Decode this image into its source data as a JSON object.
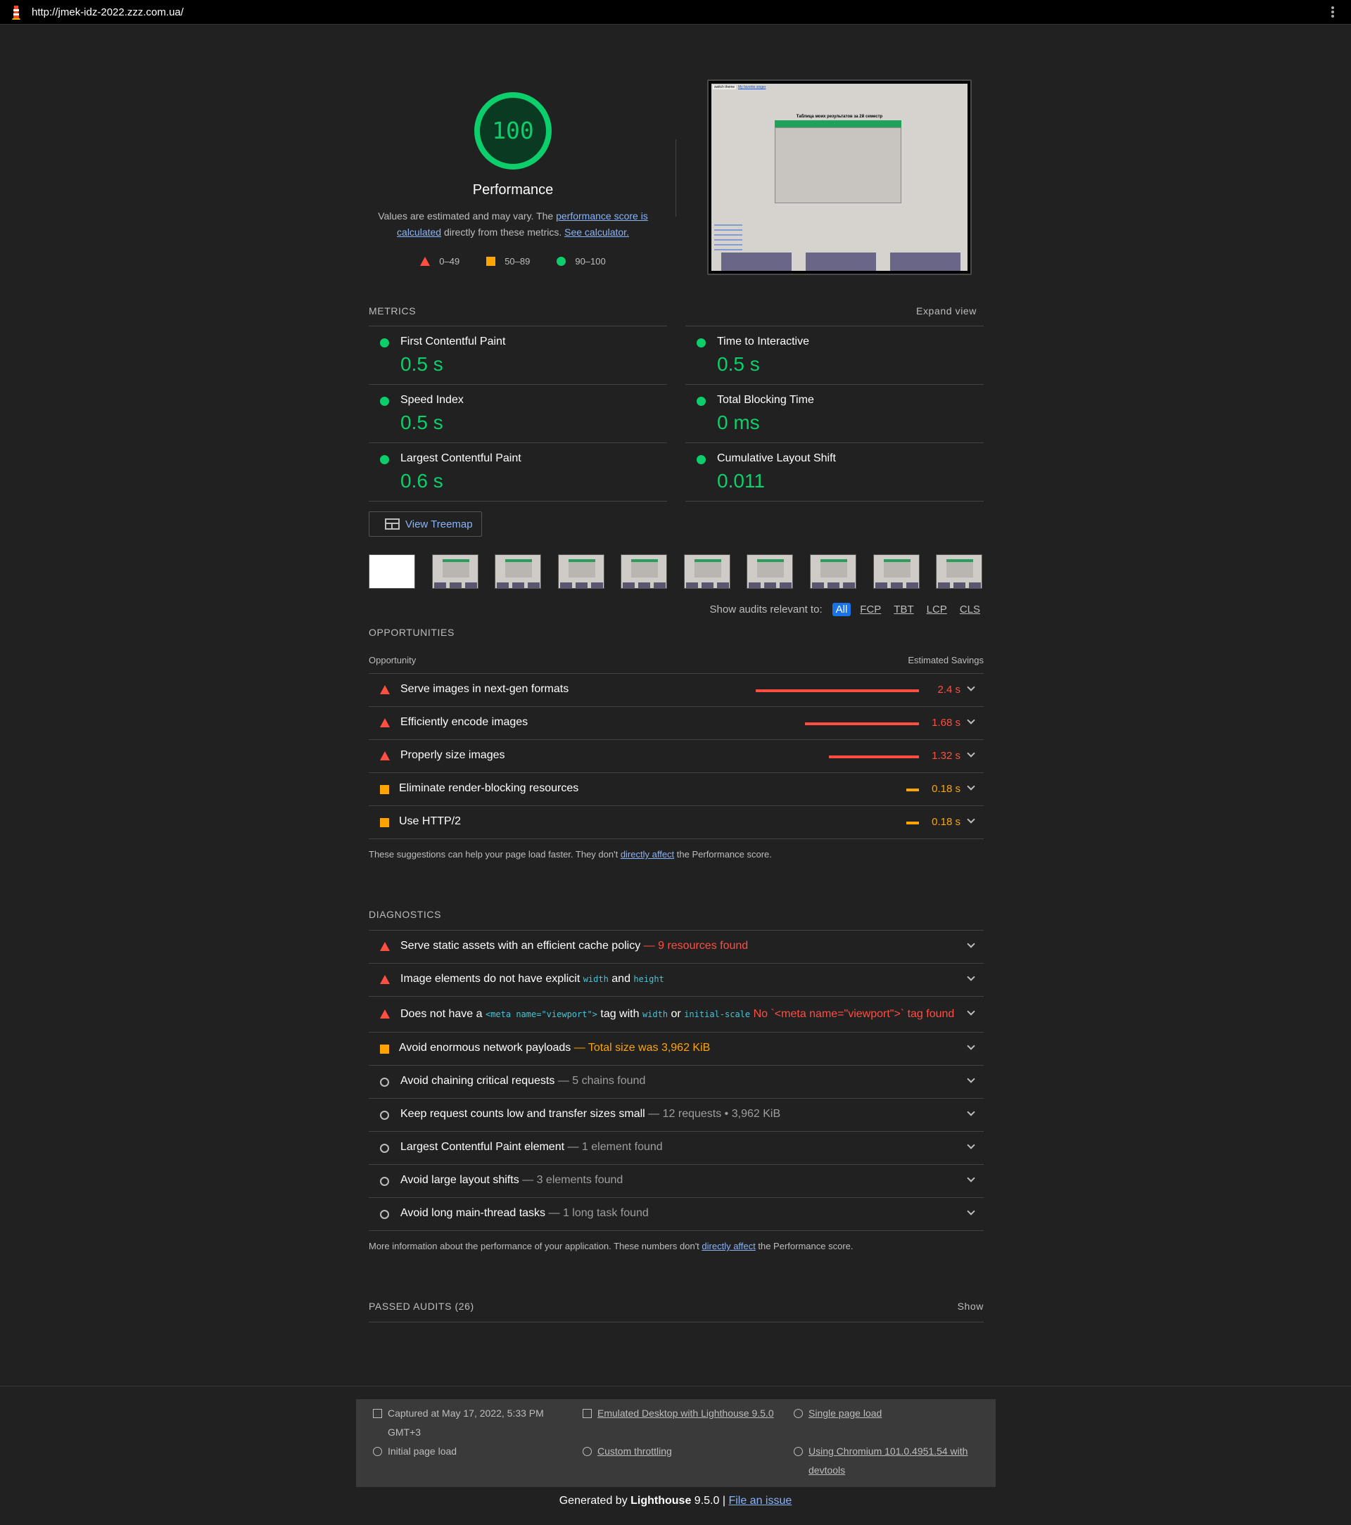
{
  "browser": {
    "url": "http://jmek-idz-2022.zzz.com.ua/"
  },
  "gauge": {
    "score": "100",
    "title": "Performance",
    "desc_1": "Values are estimated and may vary. The ",
    "desc_link_1": "performance score is calculated",
    "desc_2": " directly from these metrics. ",
    "desc_link_2": "See calculator.",
    "legend": {
      "fail": "0–49",
      "average": "50–89",
      "pass": "90–100"
    },
    "color": "#0cce6b"
  },
  "screenshot": {
    "tabs": [
      "switch theme",
      "My favorite singer"
    ],
    "table_title": "Таблица моих результатов за 2й семестр"
  },
  "metrics": {
    "heading": "METRICS",
    "expand_label": "Expand view",
    "items": [
      {
        "name": "First Contentful Paint",
        "value": "0.5 s"
      },
      {
        "name": "Time to Interactive",
        "value": "0.5 s"
      },
      {
        "name": "Speed Index",
        "value": "0.5 s"
      },
      {
        "name": "Total Blocking Time",
        "value": "0 ms"
      },
      {
        "name": "Largest Contentful Paint",
        "value": "0.6 s"
      },
      {
        "name": "Cumulative Layout Shift",
        "value": "0.011"
      }
    ]
  },
  "treemap": {
    "label": "View Treemap"
  },
  "filter": {
    "label": "Show audits relevant to:",
    "chips": [
      "All",
      "FCP",
      "TBT",
      "LCP",
      "CLS"
    ]
  },
  "opportunities": {
    "heading": "OPPORTUNITIES",
    "col_left": "Opportunity",
    "col_right": "Estimated Savings",
    "items": [
      {
        "title": "Serve images in next-gen formats",
        "saving": "2.4 s",
        "level": "fail",
        "fraction": 1.0
      },
      {
        "title": "Efficiently encode images",
        "saving": "1.68 s",
        "level": "fail",
        "fraction": 0.7
      },
      {
        "title": "Properly size images",
        "saving": "1.32 s",
        "level": "fail",
        "fraction": 0.55
      },
      {
        "title": "Eliminate render-blocking resources",
        "saving": "0.18 s",
        "level": "average",
        "fraction": 0.075
      },
      {
        "title": "Use HTTP/2",
        "saving": "0.18 s",
        "level": "average",
        "fraction": 0.075
      }
    ],
    "note_1": "These suggestions can help your page load faster. They don't ",
    "note_link": "directly affect",
    "note_2": " the Performance score."
  },
  "diagnostics": {
    "heading": "DIAGNOSTICS",
    "items": [
      {
        "title": "Serve static assets with an efficient cache policy",
        "detail": " — 9 resources found"
      },
      {
        "title_a": "Image elements do not have explicit ",
        "code_a": "width",
        "title_b": " and ",
        "code_b": "height"
      },
      {
        "title_a": "Does not have a ",
        "code_a": "<meta name=\"viewport\">",
        "title_b": " tag with ",
        "code_b": "width",
        "title_c": " or ",
        "code_c": "initial-scale",
        "detail": " No `<meta name=\"viewport\">` tag found"
      },
      {
        "title": "Avoid enormous network payloads",
        "detail": " — Total size was 3,962 KiB"
      },
      {
        "title": "Avoid chaining critical requests",
        "detail": " — 5 chains found"
      },
      {
        "title": "Keep request counts low and transfer sizes small",
        "detail": " — 12 requests • 3,962 KiB"
      },
      {
        "title": "Largest Contentful Paint element",
        "detail": " — 1 element found"
      },
      {
        "title": "Avoid large layout shifts",
        "detail": " — 3 elements found"
      },
      {
        "title": "Avoid long main-thread tasks",
        "detail": " — 1 long task found"
      }
    ],
    "note_1": "More information about the performance of your application. These numbers don't ",
    "note_link": "directly affect",
    "note_2": " the Performance score."
  },
  "passed": {
    "heading": "PASSED AUDITS (26)",
    "show_label": "Show"
  },
  "footer": {
    "captured": "Captured at May 17, 2022, 5:33 PM GMT+3",
    "initial": "Initial page load",
    "emulated": "Emulated Desktop with Lighthouse 9.5.0",
    "throttling": "Custom throttling",
    "single": "Single page load",
    "chromium": "Using Chromium 101.0.4951.54 with devtools",
    "gen_1": "Generated by ",
    "gen_brand": "Lighthouse",
    "gen_version": " 9.5.0 | ",
    "gen_link": "File an issue"
  },
  "colors": {
    "pass": "#0cce6b",
    "average": "#ffa400",
    "fail": "#ff4e42",
    "link": "#8ab4f8"
  }
}
